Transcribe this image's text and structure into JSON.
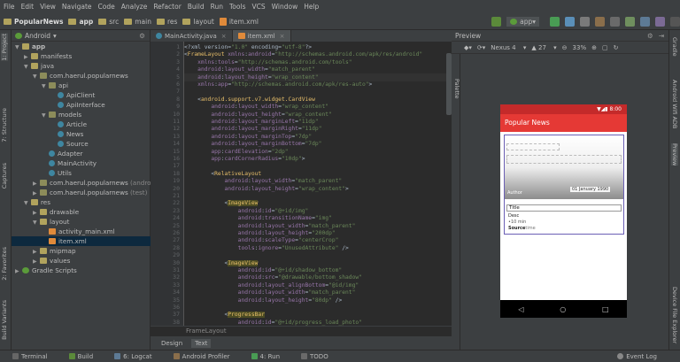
{
  "menu": [
    "File",
    "Edit",
    "View",
    "Navigate",
    "Code",
    "Analyze",
    "Refactor",
    "Build",
    "Run",
    "Tools",
    "VCS",
    "Window",
    "Help"
  ],
  "breadcrumb": {
    "project": "PopularNews",
    "app": "app",
    "src": "src",
    "main": "main",
    "res": "res",
    "layout": "layout",
    "file": "item.xml"
  },
  "toolbar": {
    "run_config": "app"
  },
  "left_tabs": {
    "project": "1: Project",
    "structure": "7: Structure",
    "captures": "Captures",
    "favorites": "2: Favorites",
    "build_variants": "Build Variants"
  },
  "project_panel": {
    "title": "Android",
    "settings": "⚙"
  },
  "tree": [
    {
      "label": "app",
      "indent": 0,
      "icon": "f",
      "arrow": "▼",
      "bold": true
    },
    {
      "label": "manifests",
      "indent": 1,
      "icon": "f",
      "arrow": "▶"
    },
    {
      "label": "java",
      "indent": 1,
      "icon": "f",
      "arrow": "▼"
    },
    {
      "label": "com.haerul.popularnews",
      "indent": 2,
      "icon": "p",
      "arrow": "▼"
    },
    {
      "label": "api",
      "indent": 3,
      "icon": "p",
      "arrow": "▼"
    },
    {
      "label": "ApiClient",
      "indent": 4,
      "icon": "c",
      "arrow": ""
    },
    {
      "label": "ApiInterface",
      "indent": 4,
      "icon": "c",
      "arrow": ""
    },
    {
      "label": "models",
      "indent": 3,
      "icon": "p",
      "arrow": "▼"
    },
    {
      "label": "Article",
      "indent": 4,
      "icon": "c",
      "arrow": ""
    },
    {
      "label": "News",
      "indent": 4,
      "icon": "c",
      "arrow": ""
    },
    {
      "label": "Source",
      "indent": 4,
      "icon": "c",
      "arrow": ""
    },
    {
      "label": "Adapter",
      "indent": 3,
      "icon": "c",
      "arrow": ""
    },
    {
      "label": "MainActivity",
      "indent": 3,
      "icon": "c",
      "arrow": ""
    },
    {
      "label": "Utils",
      "indent": 3,
      "icon": "c",
      "arrow": ""
    },
    {
      "label": "com.haerul.popularnews",
      "suffix": " (androidTest)",
      "indent": 2,
      "icon": "p",
      "arrow": "▶"
    },
    {
      "label": "com.haerul.popularnews",
      "suffix": " (test)",
      "indent": 2,
      "icon": "p",
      "arrow": "▶"
    },
    {
      "label": "res",
      "indent": 1,
      "icon": "f",
      "arrow": "▼"
    },
    {
      "label": "drawable",
      "indent": 2,
      "icon": "f",
      "arrow": "▶"
    },
    {
      "label": "layout",
      "indent": 2,
      "icon": "f",
      "arrow": "▼"
    },
    {
      "label": "activity_main.xml",
      "indent": 3,
      "icon": "x",
      "arrow": ""
    },
    {
      "label": "item.xml",
      "indent": 3,
      "icon": "x",
      "arrow": "",
      "selected": true
    },
    {
      "label": "mipmap",
      "indent": 2,
      "icon": "f",
      "arrow": "▶"
    },
    {
      "label": "values",
      "indent": 2,
      "icon": "f",
      "arrow": "▶"
    },
    {
      "label": "Gradle Scripts",
      "indent": 0,
      "icon": "g",
      "arrow": "▶"
    }
  ],
  "editor_tabs": [
    {
      "label": "MainActivity.java",
      "active": false
    },
    {
      "label": "item.xml",
      "active": true
    }
  ],
  "code": [
    "<?xml version=\"1.0\" encoding=\"utf-8\"?>",
    "<FrameLayout xmlns:android=\"http://schemas.android.com/apk/res/android\"",
    "    xmlns:tools=\"http://schemas.android.com/tools\"",
    "    android:layout_width=\"match_parent\"",
    "    android:layout_height=\"wrap_content\"",
    "    xmlns:app=\"http://schemas.android.com/apk/res-auto\">",
    "",
    "    <android.support.v7.widget.CardView",
    "        android:layout_width=\"wrap_content\"",
    "        android:layout_height=\"wrap_content\"",
    "        android:layout_marginLeft=\"11dp\"",
    "        android:layout_marginRight=\"11dp\"",
    "        android:layout_marginTop=\"7dp\"",
    "        android:layout_marginBottom=\"7dp\"",
    "        app:cardElevation=\"2dp\"",
    "        app:cardCornerRadius=\"10dp\">",
    "",
    "        <RelativeLayout",
    "            android:layout_width=\"match_parent\"",
    "            android:layout_height=\"wrap_content\">",
    "",
    "            <ImageView",
    "                android:id=\"@+id/img\"",
    "                android:transitionName=\"img\"",
    "                android:layout_width=\"match_parent\"",
    "                android:layout_height=\"200dp\"",
    "                android:scaleType=\"centerCrop\"",
    "                tools:ignore=\"UnusedAttribute\" />",
    "",
    "            <ImageView",
    "                android:id=\"@+id/shadow_bottom\"",
    "                android:src=\"@drawable/bottom_shadow\"",
    "                android:layout_alignBottom=\"@id/img\"",
    "                android:layout_width=\"match_parent\"",
    "                android:layout_height=\"80dp\" />",
    "",
    "            <ProgressBar",
    "                android:id=\"@+id/progress_load_photo\""
  ],
  "code_footer": "FrameLayout",
  "design_tabs": [
    "Design",
    "Text"
  ],
  "preview": {
    "title": "Preview",
    "device": "Nexus 4",
    "api": "27",
    "zoom": "33%",
    "status_time": "8:00",
    "app_title": "Popular News",
    "card_author": "Author",
    "card_date": "01 January 1990",
    "card_title": "Title",
    "card_desc": "Desc",
    "card_time": "•10 min",
    "card_source": "Source",
    "card_time2": "time"
  },
  "right_tabs": {
    "gradle": "Gradle",
    "explorer": "Android Wifi ADB",
    "preview": "Preview",
    "device_file": "Device File Explorer"
  },
  "bottom": [
    "Terminal",
    "Build",
    "6: Logcat",
    "Android Profiler",
    "4: Run",
    "TODO"
  ],
  "event_log": "Event Log"
}
